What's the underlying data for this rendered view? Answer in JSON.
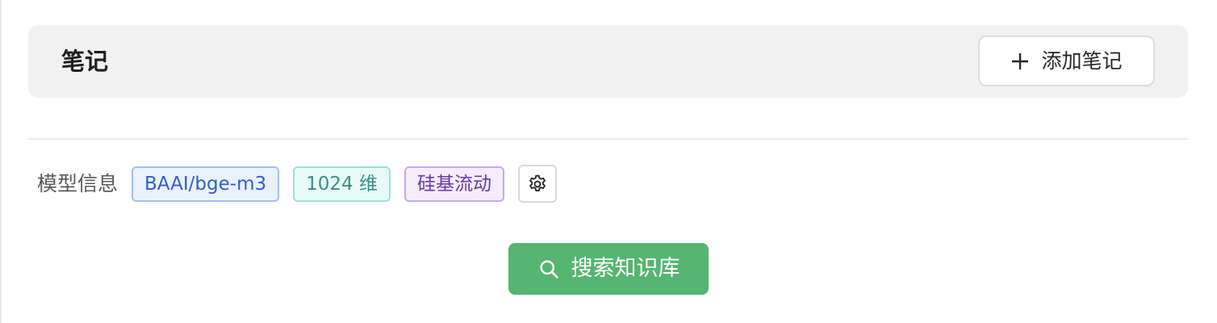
{
  "header": {
    "title": "笔记",
    "add_button_label": "添加笔记"
  },
  "model_info": {
    "label": "模型信息",
    "model_name": "BAAI/bge-m3",
    "dimensions": "1024 维",
    "provider": "硅基流动"
  },
  "search": {
    "button_label": "搜索知识库"
  },
  "colors": {
    "header_bg": "#f1f1f1",
    "search_button_bg": "#55b571",
    "tag_model": "#2f5fc7",
    "tag_dim": "#3a8f88",
    "tag_provider": "#6a35a8"
  },
  "icons": [
    "plus-icon",
    "gear-icon",
    "search-icon"
  ]
}
